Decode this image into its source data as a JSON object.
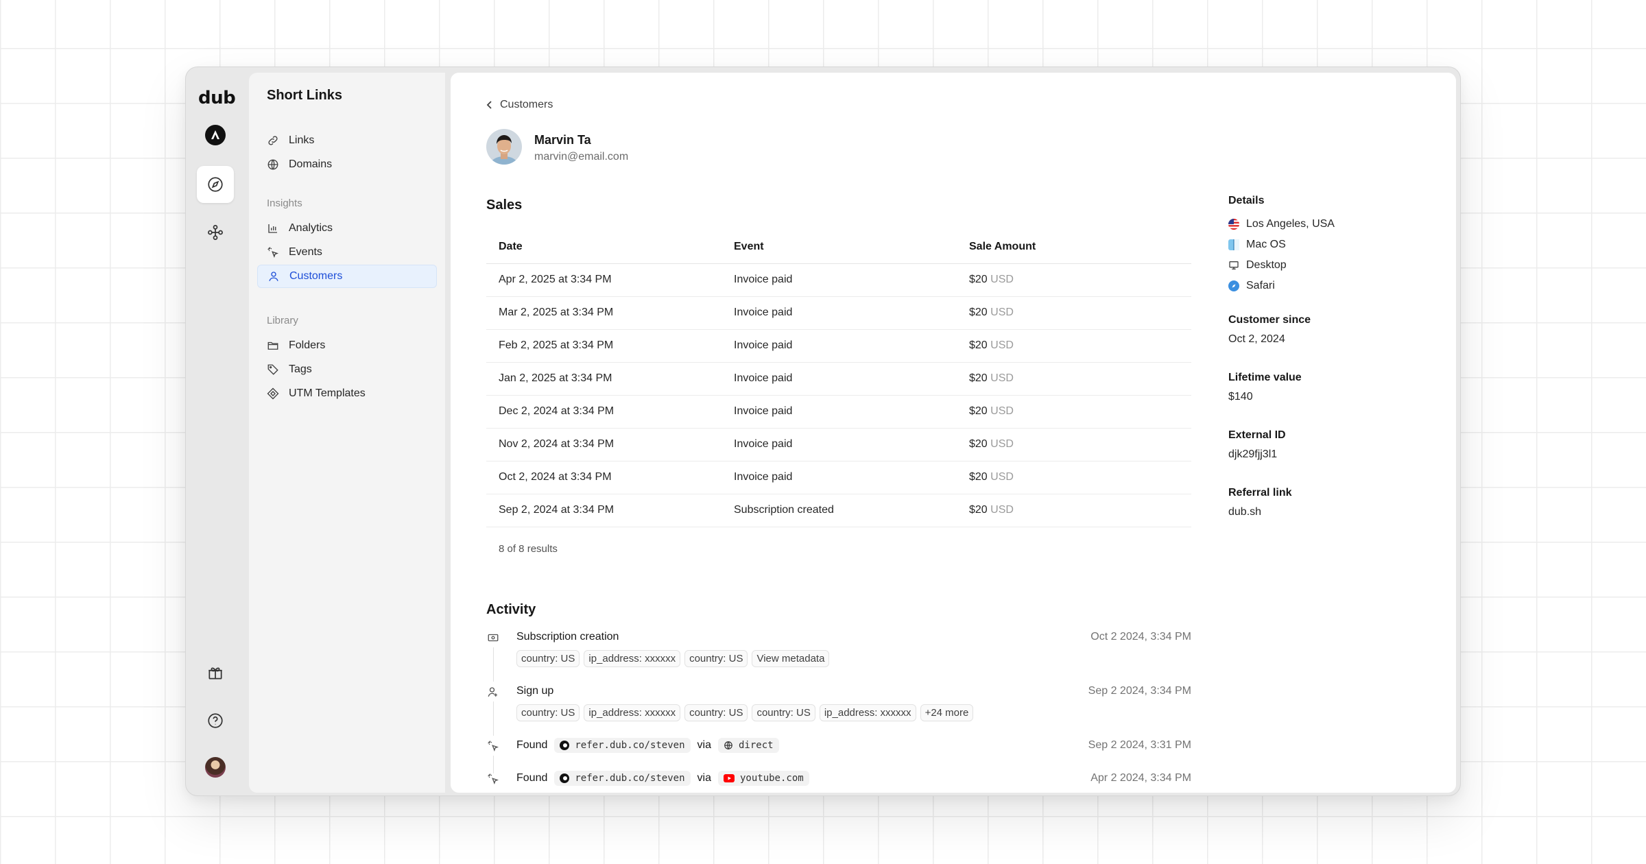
{
  "app": {
    "logo": "dub"
  },
  "sidebar": {
    "title": "Short Links",
    "items": [
      {
        "label": "Links",
        "icon": "link-icon"
      },
      {
        "label": "Domains",
        "icon": "globe-icon"
      }
    ],
    "insights_label": "Insights",
    "insights": [
      {
        "label": "Analytics",
        "icon": "chart-icon"
      },
      {
        "label": "Events",
        "icon": "cursor-rays-icon"
      },
      {
        "label": "Customers",
        "icon": "user-icon",
        "active": true
      }
    ],
    "library_label": "Library",
    "library": [
      {
        "label": "Folders",
        "icon": "folder-icon"
      },
      {
        "label": "Tags",
        "icon": "tag-icon"
      },
      {
        "label": "UTM Templates",
        "icon": "diamond-icon"
      }
    ]
  },
  "breadcrumb": {
    "label": "Customers"
  },
  "customer": {
    "name": "Marvin Ta",
    "email": "marvin@email.com"
  },
  "sales": {
    "title": "Sales",
    "columns": [
      "Date",
      "Event",
      "Sale Amount"
    ],
    "rows": [
      {
        "date": "Apr 2, 2025 at 3:34 PM",
        "event": "Invoice paid",
        "amount": "$20",
        "currency": "USD"
      },
      {
        "date": "Mar 2, 2025 at 3:34 PM",
        "event": "Invoice paid",
        "amount": "$20",
        "currency": "USD"
      },
      {
        "date": "Feb 2, 2025 at 3:34 PM",
        "event": "Invoice paid",
        "amount": "$20",
        "currency": "USD"
      },
      {
        "date": "Jan 2, 2025 at 3:34 PM",
        "event": "Invoice paid",
        "amount": "$20",
        "currency": "USD"
      },
      {
        "date": "Dec 2, 2024 at 3:34 PM",
        "event": "Invoice paid",
        "amount": "$20",
        "currency": "USD"
      },
      {
        "date": "Nov 2, 2024 at 3:34 PM",
        "event": "Invoice paid",
        "amount": "$20",
        "currency": "USD"
      },
      {
        "date": "Oct 2, 2024 at 3:34 PM",
        "event": "Invoice paid",
        "amount": "$20",
        "currency": "USD"
      },
      {
        "date": "Sep 2, 2024 at 3:34 PM",
        "event": "Subscription created",
        "amount": "$20",
        "currency": "USD"
      }
    ],
    "results": "8 of 8 results"
  },
  "activity": {
    "title": "Activity",
    "items": [
      {
        "title": "Subscription creation",
        "time": "Oct 2 2024, 3:34 PM",
        "chips": [
          "country: US",
          "ip_address: xxxxxx",
          "country: US",
          "View metadata"
        ]
      },
      {
        "title": "Sign up",
        "time": "Sep 2 2024, 3:34 PM",
        "chips": [
          "country: US",
          "ip_address: xxxxxx",
          "country: US",
          "country: US",
          "ip_address: xxxxxx",
          "+24 more"
        ]
      },
      {
        "title": "Found",
        "link": "refer.dub.co/steven",
        "via": "via",
        "source": "direct",
        "time": "Sep 2 2024, 3:31 PM"
      },
      {
        "title": "Found",
        "link": "refer.dub.co/steven",
        "via": "via",
        "source": "youtube.com",
        "time": "Apr 2 2024, 3:34 PM"
      }
    ]
  },
  "details": {
    "title": "Details",
    "location": "Los Angeles, USA",
    "os": "Mac OS",
    "device": "Desktop",
    "browser": "Safari",
    "customer_since_label": "Customer since",
    "customer_since": "Oct 2, 2024",
    "lifetime_value_label": "Lifetime value",
    "lifetime_value": "$140",
    "external_id_label": "External ID",
    "external_id": "djk29fjj3l1",
    "referral_link_label": "Referral link",
    "referral_link": "dub.sh"
  },
  "colors": {
    "accent": "#1d4ed8",
    "active_bg": "#e8f1fd",
    "youtube": "#ff0000"
  }
}
